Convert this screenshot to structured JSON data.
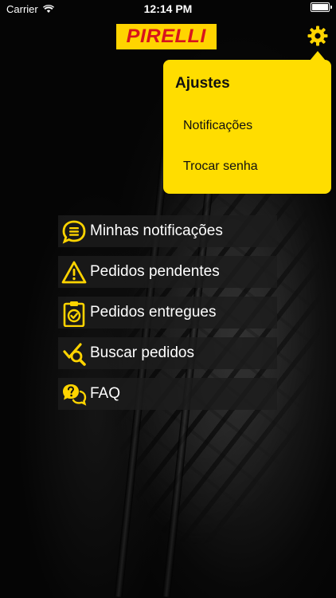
{
  "status_bar": {
    "carrier": "Carrier",
    "time": "12:14 PM",
    "battery_level": 1.0
  },
  "logo": {
    "text": "PIRELLI"
  },
  "settings_popover": {
    "title": "Ajustes",
    "items": [
      {
        "label": "Notificações"
      },
      {
        "label": "Trocar senha"
      }
    ]
  },
  "menu": {
    "items": [
      {
        "label": "Minhas notificações",
        "icon": "chat-list-icon"
      },
      {
        "label": "Pedidos pendentes",
        "icon": "warning-icon"
      },
      {
        "label": "Pedidos entregues",
        "icon": "clipboard-check-icon"
      },
      {
        "label": "Buscar pedidos",
        "icon": "search-check-icon"
      },
      {
        "label": "FAQ",
        "icon": "question-chat-icon"
      }
    ]
  },
  "colors": {
    "accent": "#FFD400",
    "brand_red": "#D8141C",
    "menu_bg": "#1C1C1C"
  }
}
